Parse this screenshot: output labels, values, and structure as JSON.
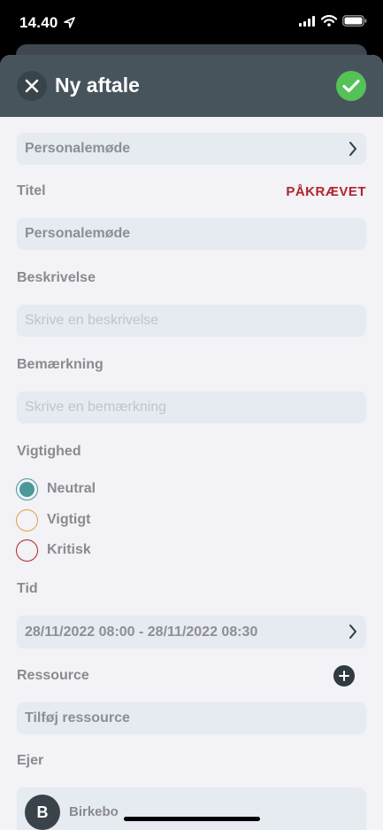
{
  "status_bar": {
    "time": "14.40"
  },
  "nav": {
    "title": "Ny aftale"
  },
  "template": {
    "value": "Personalemøde"
  },
  "title_field": {
    "label": "Titel",
    "required_label": "PÅKRÆVET",
    "value": "Personalemøde"
  },
  "description": {
    "label": "Beskrivelse",
    "placeholder": "Skrive en beskrivelse"
  },
  "remark": {
    "label": "Bemærkning",
    "placeholder": "Skrive en bemærkning"
  },
  "importance": {
    "label": "Vigtighed",
    "options": [
      {
        "label": "Neutral",
        "color": "#4a9898",
        "selected": true
      },
      {
        "label": "Vigtigt",
        "color": "#e0a43a",
        "selected": false
      },
      {
        "label": "Kritisk",
        "color": "#b0242a",
        "selected": false
      }
    ]
  },
  "time": {
    "label": "Tid",
    "value": "28/11/2022 08:00 - 28/11/2022 08:30"
  },
  "resource": {
    "label": "Ressource",
    "placeholder": "Tilføj ressource"
  },
  "owner": {
    "label": "Ejer",
    "initial": "B",
    "name": "Birkebo"
  },
  "colors": {
    "header": "#48545c",
    "accent_green": "#55c257",
    "field_bg": "#e6eaf1",
    "required": "#b0242a"
  }
}
